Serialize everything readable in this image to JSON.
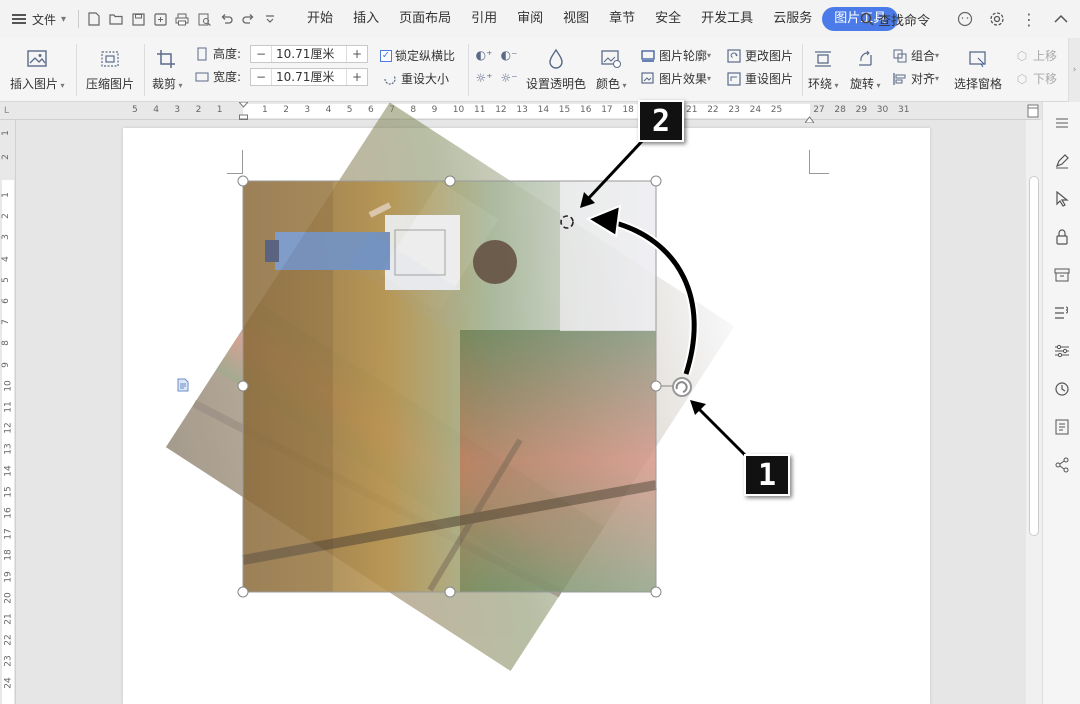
{
  "menu": {
    "file_label": "文件",
    "tabs": [
      "开始",
      "插入",
      "页面布局",
      "引用",
      "审阅",
      "视图",
      "章节",
      "安全",
      "开发工具",
      "云服务"
    ],
    "active_tab": "图片工具",
    "search_label": "查找命令"
  },
  "ribbon": {
    "insert_picture": "插入图片",
    "compress_picture": "压缩图片",
    "crop": "裁剪",
    "height_label": "高度:",
    "height_value": "10.71厘米",
    "width_label": "宽度:",
    "width_value": "10.71厘米",
    "lock_ratio": "锁定纵横比",
    "reset_size": "重设大小",
    "set_transparent": "设置透明色",
    "color": "颜色",
    "picture_outline": "图片轮廓",
    "picture_effect": "图片效果",
    "change_picture": "更改图片",
    "reset_picture": "重设图片",
    "wrap": "环绕",
    "rotate": "旋转",
    "group": "组合",
    "align": "对齐",
    "selection_pane": "选择窗格",
    "bring_forward": "上移",
    "send_backward": "下移"
  },
  "ruler": {
    "h_left": [
      "5",
      "4",
      "3",
      "2",
      "1"
    ],
    "h_right": [
      "1",
      "2",
      "3",
      "4",
      "5",
      "6",
      "7",
      "8",
      "9",
      "10",
      "11",
      "12",
      "13",
      "14",
      "15",
      "16",
      "17",
      "18",
      "19",
      "20",
      "21",
      "22",
      "23",
      "24",
      "25",
      "27",
      "28",
      "29",
      "30",
      "31"
    ],
    "v_top": [
      "1",
      "2"
    ],
    "v_main": [
      "1",
      "2",
      "3",
      "4",
      "5",
      "6",
      "7",
      "8",
      "9",
      "10",
      "11",
      "12",
      "13",
      "14",
      "15",
      "16",
      "17",
      "18",
      "19",
      "20",
      "21",
      "22",
      "23",
      "24"
    ]
  },
  "callouts": {
    "one": "1",
    "two": "2"
  },
  "colors": {
    "accent": "#4a7be8",
    "handle": "#888888"
  }
}
